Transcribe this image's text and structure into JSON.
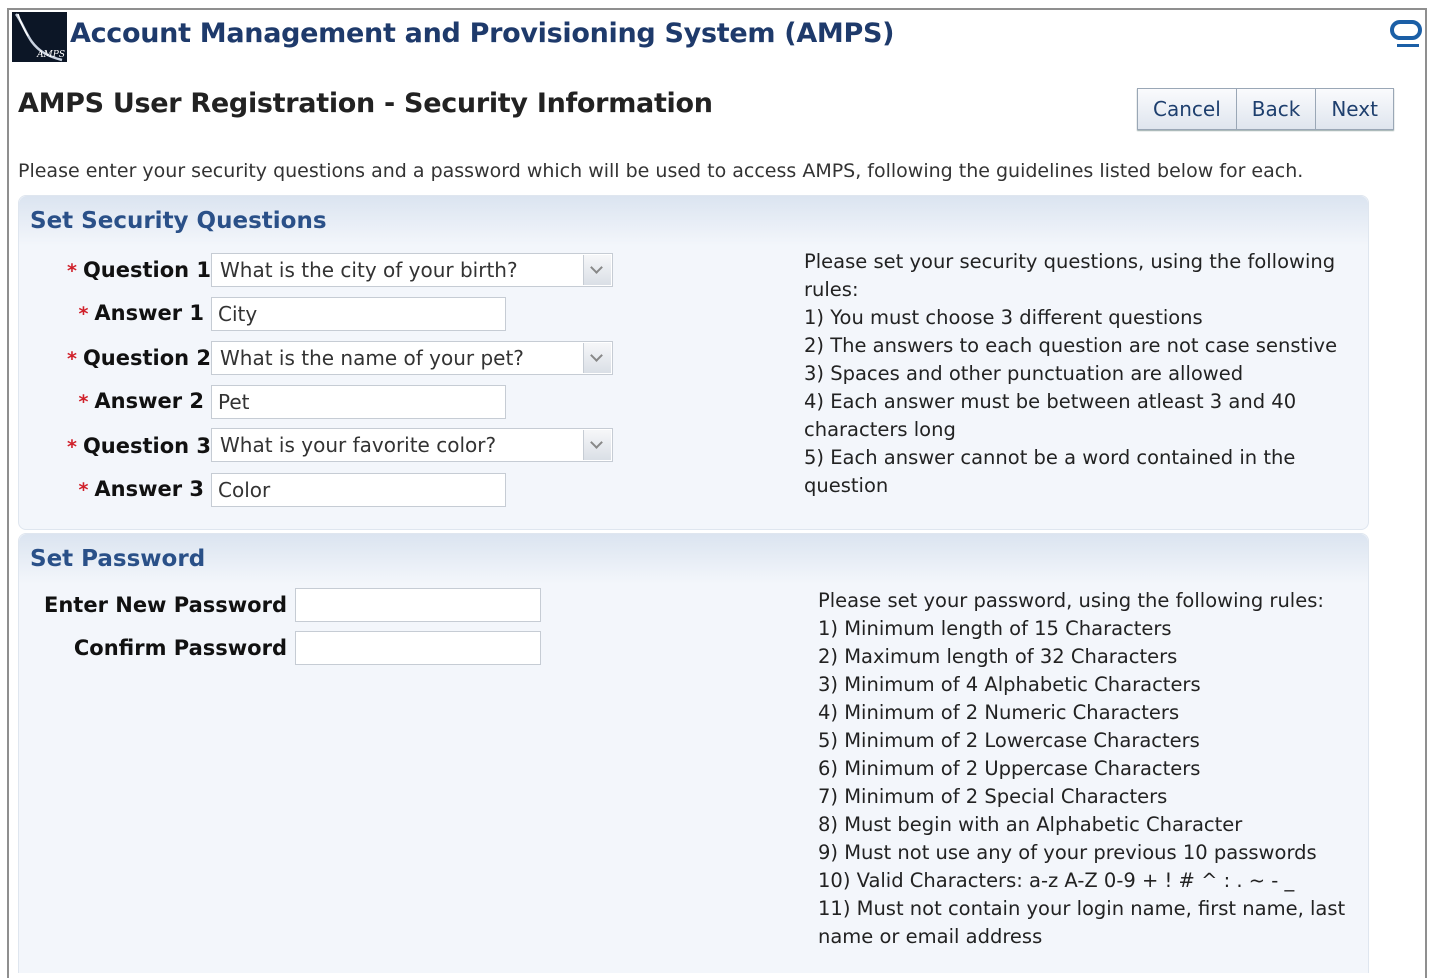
{
  "header": {
    "logo_text": "AMPS",
    "app_title": "Account Management and Provisioning System (AMPS)"
  },
  "page": {
    "title": "AMPS User Registration - Security Information",
    "instructions": "Please enter your security questions and a password which will be used to access AMPS, following the guidelines listed below for each."
  },
  "toolbar": {
    "cancel_label": "Cancel",
    "back_label": "Back",
    "next_label": "Next"
  },
  "security_questions": {
    "heading": "Set Security Questions",
    "required_marker": "*",
    "fields": [
      {
        "question_label": "Question 1",
        "question_value": "What is the city of your birth?",
        "answer_label": "Answer 1",
        "answer_value": "City"
      },
      {
        "question_label": "Question 2",
        "question_value": "What is the name of your pet?",
        "answer_label": "Answer 2",
        "answer_value": "Pet"
      },
      {
        "question_label": "Question 3",
        "question_value": "What is your favorite color?",
        "answer_label": "Answer 3",
        "answer_value": "Color"
      }
    ],
    "rules": [
      "Please set your security questions, using the following",
      "rules:",
      "1) You must choose 3 different questions",
      "2) The answers to each question are not case senstive",
      "3) Spaces and other punctuation are allowed",
      "4) Each answer must be between atleast 3 and 40",
      "characters long",
      "5) Each answer cannot be a word contained in the",
      "question"
    ]
  },
  "password": {
    "heading": "Set Password",
    "new_label": "Enter New Password",
    "new_value": "",
    "confirm_label": "Confirm Password",
    "confirm_value": "",
    "rules": [
      "Please set your password, using the following rules:",
      "1) Minimum length of 15 Characters",
      "2) Maximum length of 32 Characters",
      "3) Minimum of 4 Alphabetic Characters",
      "4) Minimum of 2 Numeric Characters",
      "5) Minimum of 2 Lowercase Characters",
      "6) Minimum of 2 Uppercase Characters",
      "7) Minimum of 2 Special Characters",
      "8) Must begin with an Alphabetic Character",
      "9) Must not use any of your previous 10 passwords",
      "10) Valid Characters: a-z A-Z 0-9 + ! # ^ : . ~ - _",
      "11) Must not contain your login name, first name, last",
      "name or email address"
    ]
  },
  "colors": {
    "title_blue": "#1e3a6b",
    "panel_heading": "#2a5088",
    "required_red": "#d0202a",
    "panel_bg": "#f3f6fb"
  },
  "icons": {
    "logo": "amps-logo-icon",
    "brand": "oracle-icon",
    "select_arrow": "chevron-down-icon"
  }
}
